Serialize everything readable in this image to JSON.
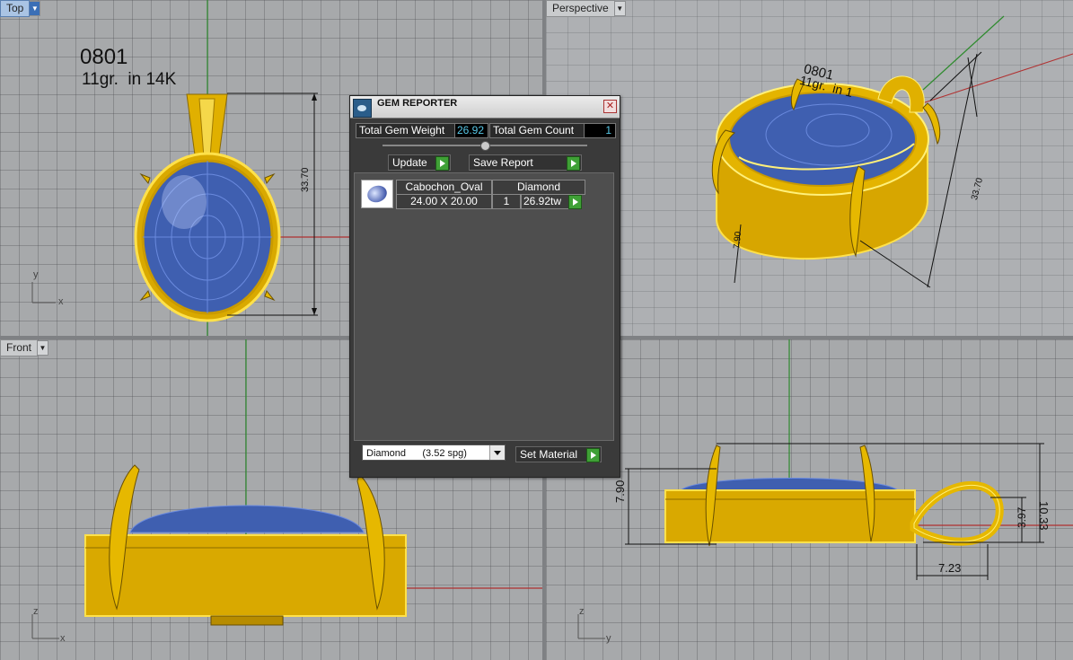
{
  "viewports": {
    "top": {
      "label": "Top",
      "axis_x": "x",
      "axis_y": "y",
      "note_id": "0801",
      "note_weight": "11gr.  in 14K",
      "dim_height": "33.70"
    },
    "perspective": {
      "label": "Perspective",
      "note_id": "0801",
      "note_weight": "11gr.  in 1",
      "dim_length": "33.70",
      "dim_side": "7.90"
    },
    "front": {
      "label": "Front",
      "axis_x": "x",
      "axis_y": "z"
    },
    "right": {
      "axis_x": "y",
      "axis_y": "z",
      "dim_height": "7.90",
      "dim_total": "10.33",
      "dim_bail": "3.97",
      "dim_bail_width": "7.23"
    }
  },
  "gem_reporter": {
    "title": "GEM REPORTER",
    "total_weight_label": "Total Gem Weight",
    "total_weight_value": "26.92",
    "total_count_label": "Total Gem Count",
    "total_count_value": "1",
    "update_label": "Update",
    "save_report_label": "Save Report",
    "gems": [
      {
        "cut": "Cabochon_Oval",
        "material": "Diamond",
        "size": "24.00 X 20.00",
        "count": "1",
        "weight": "26.92tw"
      }
    ],
    "material_selected": "Diamond      (3.52 spg)",
    "set_material_label": "Set Material"
  },
  "colors": {
    "gold": "#e6b800",
    "gold_dark": "#8a6a00",
    "gem_blue": "#4a6ab8",
    "axis_green": "#2e8b2e",
    "axis_red": "#b03030"
  }
}
